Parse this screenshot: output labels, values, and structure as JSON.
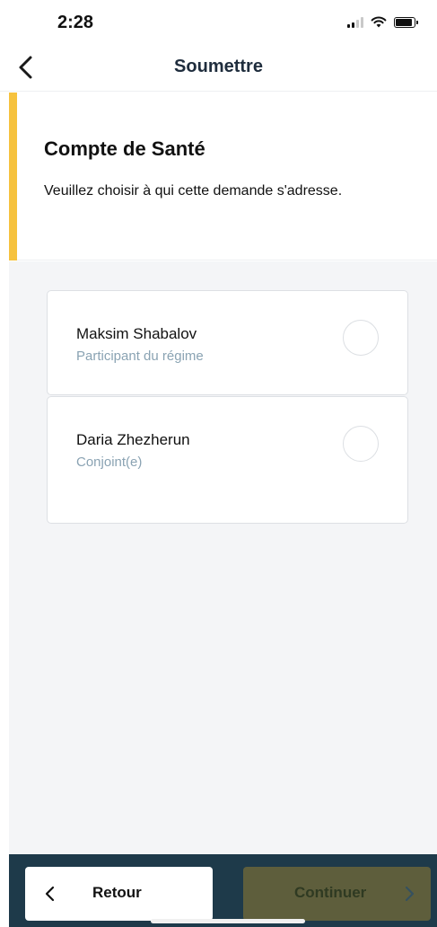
{
  "status_bar": {
    "time": "2:28",
    "icons": [
      "signal-icon",
      "wifi-icon",
      "battery-icon"
    ]
  },
  "nav": {
    "title": "Soumettre",
    "back_icon": "chevron-left-icon"
  },
  "header": {
    "title": "Compte de Santé",
    "subtitle": "Veuillez choisir à qui cette demande s'adresse.",
    "accent_color": "#f6c23e"
  },
  "options": [
    {
      "name": "Maksim Shabalov",
      "role": "Participant du régime",
      "selected": false
    },
    {
      "name": "Daria Zhezherun",
      "role": "Conjoint(e)",
      "selected": false
    }
  ],
  "footer": {
    "back_label": "Retour",
    "continue_label": "Continuer",
    "continue_enabled": false,
    "background_color": "#1e3a4a",
    "continue_color": "#5e5e3c"
  }
}
